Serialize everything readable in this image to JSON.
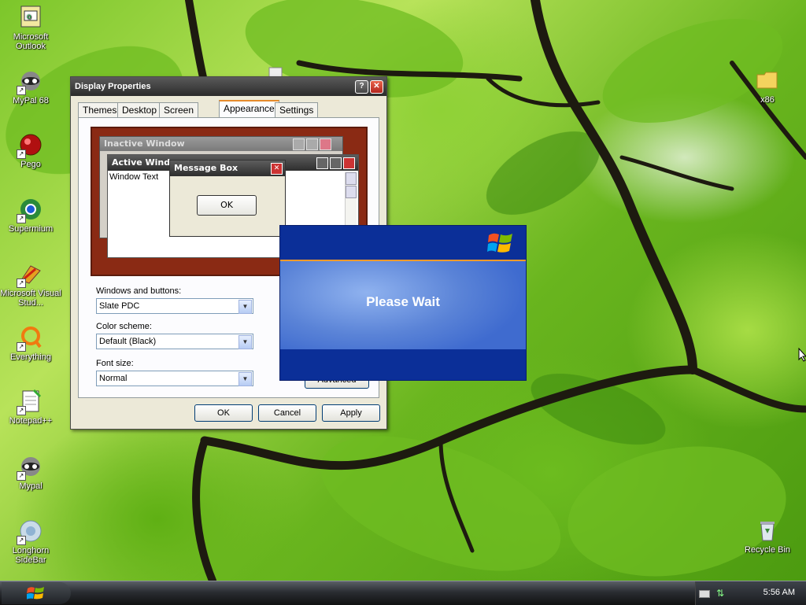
{
  "desktop_icons": [
    {
      "label": "Microsoft Outlook"
    },
    {
      "label": "MyPal 68"
    },
    {
      "label": "Pego"
    },
    {
      "label": "Supermium"
    },
    {
      "label": "Microsoft Visual Stud..."
    },
    {
      "label": "Everything"
    },
    {
      "label": "Notepad++"
    },
    {
      "label": "Mypal"
    },
    {
      "label": "Longhorn SideBar"
    },
    {
      "label": "x86"
    },
    {
      "label": "Recycle Bin"
    }
  ],
  "display_properties": {
    "title": "Display Properties",
    "tabs": [
      "Themes",
      "Desktop",
      "Screen Saver",
      "Appearance",
      "Settings"
    ],
    "active_tab": "Appearance",
    "preview": {
      "inactive_window": "Inactive Window",
      "active_window": "Active Window",
      "window_text": "Window Text",
      "message_box": "Message Box",
      "ok": "OK"
    },
    "windows_and_buttons_label": "Windows and buttons:",
    "windows_and_buttons_value": "Slate PDC",
    "color_scheme_label": "Color scheme:",
    "color_scheme_value": "Default (Black)",
    "font_size_label": "Font size:",
    "font_size_value": "Normal",
    "advanced": "Advanced",
    "ok": "OK",
    "cancel": "Cancel",
    "apply": "Apply"
  },
  "please_wait": {
    "message": "Please Wait"
  },
  "taskbar": {
    "clock": "5:56 AM"
  }
}
